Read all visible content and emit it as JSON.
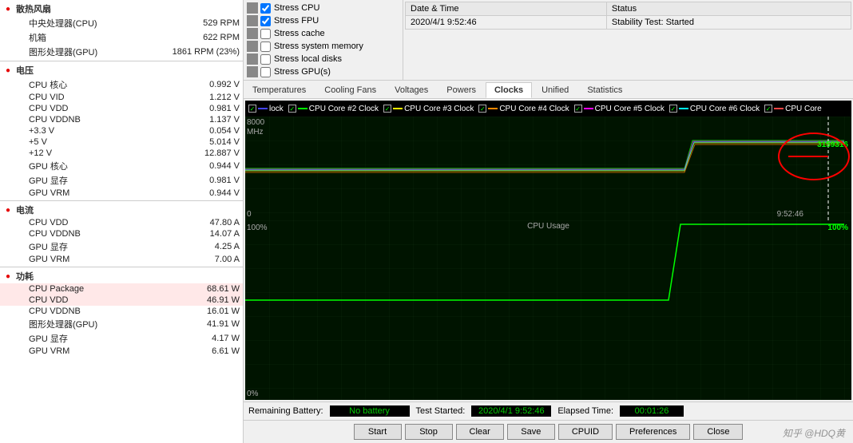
{
  "leftPanel": {
    "sections": [
      {
        "id": "fans",
        "label": "散热风扇",
        "icon": "●",
        "items": [
          {
            "label": "中央处理器(CPU)",
            "value": "529 RPM",
            "indent": 1
          },
          {
            "label": "机箱",
            "value": "622 RPM",
            "indent": 1
          },
          {
            "label": "图形处理器(GPU)",
            "value": "1861 RPM (23%)",
            "indent": 1
          }
        ]
      },
      {
        "id": "voltage",
        "label": "电压",
        "icon": "●",
        "items": [
          {
            "label": "CPU 核心",
            "value": "0.992 V",
            "indent": 1
          },
          {
            "label": "CPU VID",
            "value": "1.212 V",
            "indent": 1
          },
          {
            "label": "CPU VDD",
            "value": "0.981 V",
            "indent": 1
          },
          {
            "label": "CPU VDDNB",
            "value": "1.137 V",
            "indent": 1
          },
          {
            "label": "+3.3 V",
            "value": "0.054 V",
            "indent": 1
          },
          {
            "label": "+5 V",
            "value": "5.014 V",
            "indent": 1
          },
          {
            "label": "+12 V",
            "value": "12.887 V",
            "indent": 1
          },
          {
            "label": "GPU 核心",
            "value": "0.944 V",
            "indent": 1
          },
          {
            "label": "GPU 显存",
            "value": "0.981 V",
            "indent": 1
          },
          {
            "label": "GPU VRM",
            "value": "0.944 V",
            "indent": 1
          }
        ]
      },
      {
        "id": "current",
        "label": "电流",
        "icon": "●",
        "items": [
          {
            "label": "CPU VDD",
            "value": "47.80 A",
            "indent": 1
          },
          {
            "label": "CPU VDDNB",
            "value": "14.07 A",
            "indent": 1
          },
          {
            "label": "GPU 显存",
            "value": "4.25 A",
            "indent": 1
          },
          {
            "label": "GPU VRM",
            "value": "7.00 A",
            "indent": 1
          }
        ]
      },
      {
        "id": "power",
        "label": "功耗",
        "icon": "●",
        "items": [
          {
            "label": "CPU Package",
            "value": "68.61 W",
            "indent": 1,
            "highlight": true
          },
          {
            "label": "CPU VDD",
            "value": "46.91 W",
            "indent": 1,
            "highlight": true
          },
          {
            "label": "CPU VDDNB",
            "value": "16.01 W",
            "indent": 1
          },
          {
            "label": "图形处理器(GPU)",
            "value": "41.91 W",
            "indent": 1
          },
          {
            "label": "GPU 显存",
            "value": "4.17 W",
            "indent": 1
          },
          {
            "label": "GPU VRM",
            "value": "6.61 W",
            "indent": 1
          }
        ]
      }
    ]
  },
  "stressTests": {
    "title": "Stress Tests",
    "items": [
      {
        "id": "cpu",
        "label": "Stress CPU",
        "checked": true
      },
      {
        "id": "fpu",
        "label": "Stress FPU",
        "checked": true
      },
      {
        "id": "cache",
        "label": "Stress cache",
        "checked": false
      },
      {
        "id": "memory",
        "label": "Stress system memory",
        "checked": false
      },
      {
        "id": "disks",
        "label": "Stress local disks",
        "checked": false
      },
      {
        "id": "gpu",
        "label": "Stress GPU(s)",
        "checked": false
      }
    ]
  },
  "statusTable": {
    "headers": [
      "Date & Time",
      "Status"
    ],
    "rows": [
      {
        "datetime": "2020/4/1 9:52:46",
        "status": "Stability Test: Started"
      }
    ]
  },
  "tabs": [
    {
      "id": "temperatures",
      "label": "Temperatures",
      "active": false
    },
    {
      "id": "cooling-fans",
      "label": "Cooling Fans",
      "active": false
    },
    {
      "id": "voltages",
      "label": "Voltages",
      "active": false
    },
    {
      "id": "powers",
      "label": "Powers",
      "active": false
    },
    {
      "id": "clocks",
      "label": "Clocks",
      "active": true
    },
    {
      "id": "unified",
      "label": "Unified",
      "active": false
    },
    {
      "id": "statistics",
      "label": "Statistics",
      "active": false
    }
  ],
  "clockChart": {
    "legendItems": [
      {
        "label": "lock",
        "color": "#4444ff"
      },
      {
        "label": "CPU Core #2 Clock",
        "color": "#00ff00"
      },
      {
        "label": "CPU Core #3 Clock",
        "color": "#ffff00"
      },
      {
        "label": "CPU Core #4 Clock",
        "color": "#ff8800"
      },
      {
        "label": "CPU Core #5 Clock",
        "color": "#ff00ff"
      },
      {
        "label": "CPU Core #6 Clock",
        "color": "#00ffff"
      },
      {
        "label": "CPU Core",
        "color": "#ff4444"
      }
    ],
    "yMax": "8000",
    "yUnit": "MHz",
    "yZero": "0",
    "timestamp": "9:52:46",
    "valueRight": "3159316",
    "chartTitle": "CPU Core Clock"
  },
  "cpuUsageChart": {
    "title": "CPU Usage",
    "yTop": "100%",
    "yBottom": "0%",
    "valueRight": "100%"
  },
  "bottomStatus": {
    "batteryLabel": "Remaining Battery:",
    "batteryValue": "No battery",
    "testStartedLabel": "Test Started:",
    "testStartedValue": "2020/4/1 9:52:46",
    "elapsedLabel": "Elapsed Time:",
    "elapsedValue": "00:01:26"
  },
  "buttons": {
    "start": "Start",
    "stop": "Stop",
    "clear": "Clear",
    "save": "Save",
    "cpuid": "CPUID",
    "preferences": "Preferences",
    "close": "Close"
  },
  "watermark": "知乎 @HDQ黄"
}
